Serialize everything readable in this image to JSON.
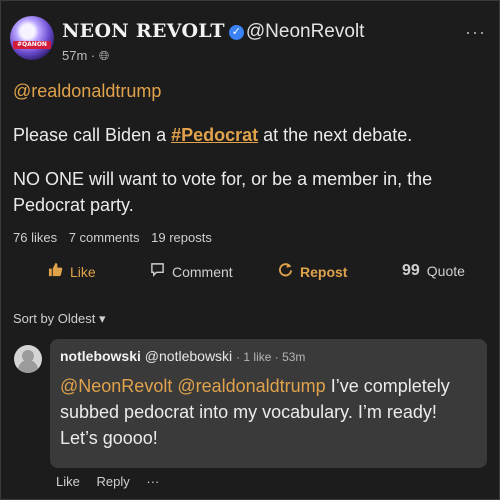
{
  "post": {
    "author": {
      "display_name": "NEON REVOLT",
      "handle": "@NeonRevolt",
      "avatar_badge": "#QANON",
      "verified_icon": "verified-check-icon"
    },
    "time": "57m",
    "visibility_icon": "globe-icon",
    "mention": "@realdonaldtrump",
    "paragraph1_prefix": "Please call Biden a ",
    "hashtag": "#Pedocrat",
    "paragraph1_suffix": " at the next debate.",
    "paragraph2": "NO ONE will want to vote for, or be a member in, the Pedocrat party.",
    "stats": {
      "likes": "76 likes",
      "comments": "7 comments",
      "reposts": "19 reposts"
    },
    "actions": {
      "like": "Like",
      "comment": "Comment",
      "repost": "Repost",
      "quote": "Quote"
    }
  },
  "sort": {
    "label": "Sort by Oldest",
    "caret": "▾"
  },
  "comment": {
    "name": "notlebowski",
    "handle": "@notlebowski",
    "meta": "· 1 like · 53m",
    "mentions": "@NeonRevolt @realdonaldtrump",
    "text": " I’ve completely subbed pedocrat into my vocabulary. I’m ready! Let’s goooo!",
    "actions": {
      "like": "Like",
      "reply": "Reply",
      "more": "···"
    }
  },
  "colors": {
    "accent": "#e0a24a",
    "background": "#1c1c1d",
    "bubble": "#3a3a3b",
    "verified": "#3b82f6"
  }
}
